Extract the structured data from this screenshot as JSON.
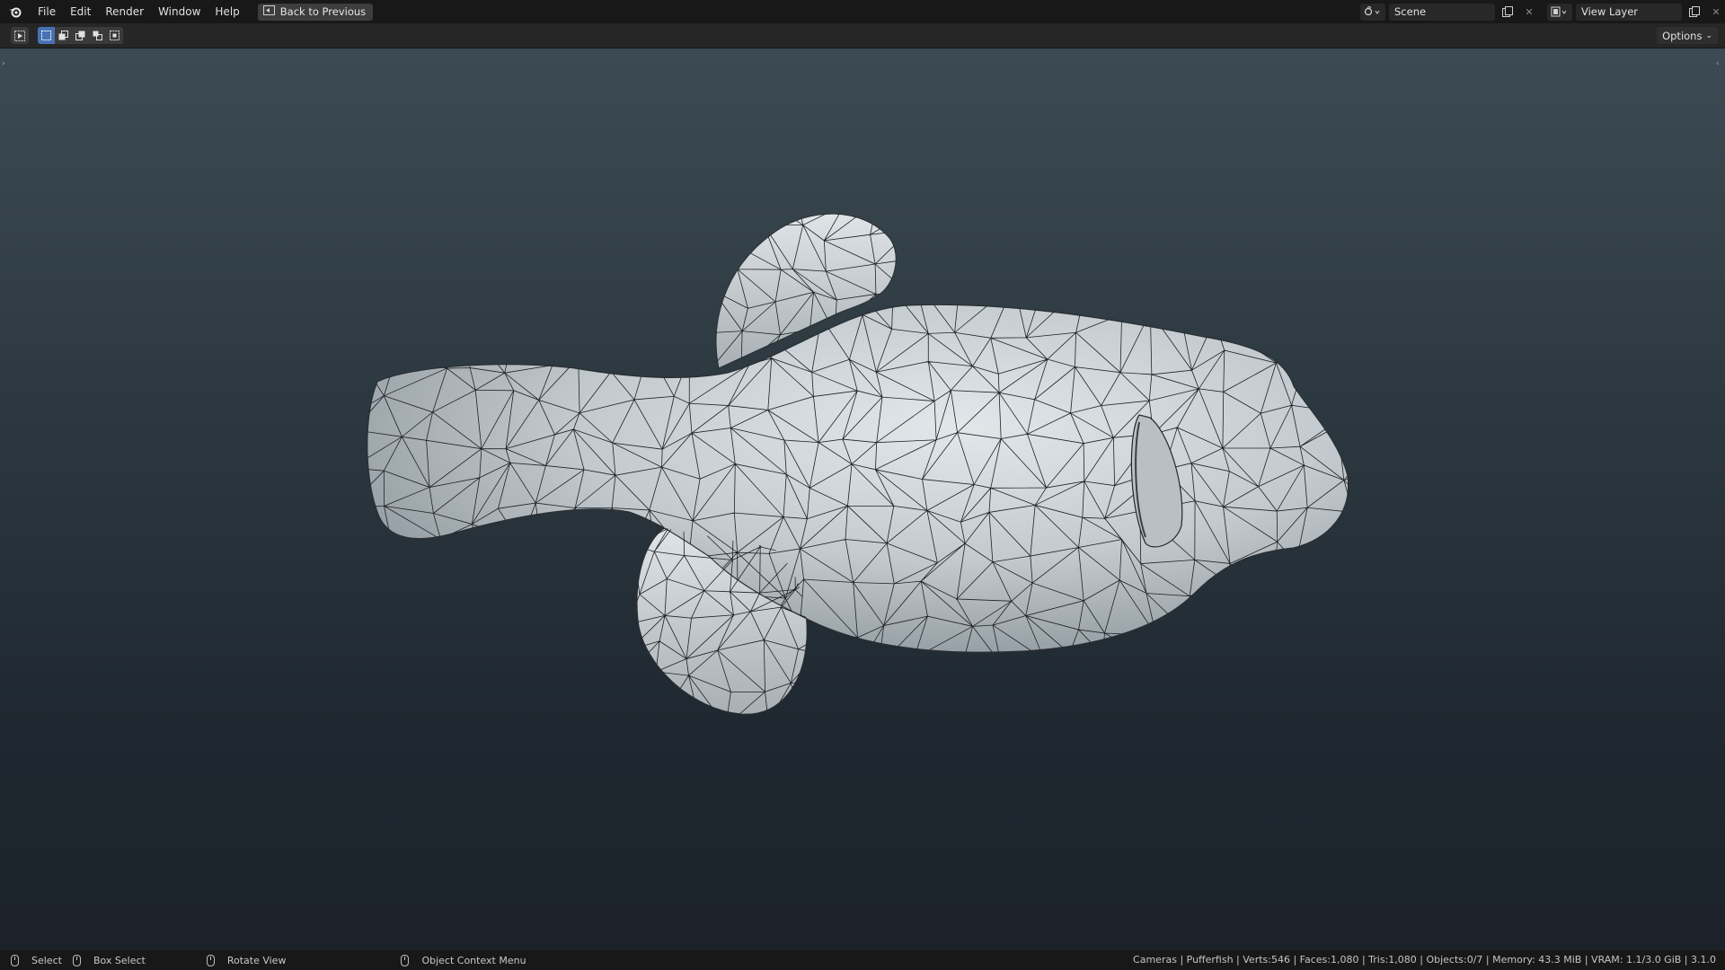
{
  "menu": {
    "items": [
      "File",
      "Edit",
      "Render",
      "Window",
      "Help"
    ],
    "back_button": "Back to Previous"
  },
  "top_right": {
    "scene_name": "Scene",
    "view_layer_name": "View Layer"
  },
  "header": {
    "options_label": "Options"
  },
  "status": {
    "select": "Select",
    "box_select": "Box Select",
    "rotate_view": "Rotate View",
    "context_menu": "Object Context Menu",
    "stats": "Cameras | Pufferfish | Verts:546 | Faces:1,080 | Tris:1,080 | Objects:0/7 | Memory: 43.3 MiB | VRAM: 1.1/3.0 GiB | 3.1.0"
  },
  "colors": {
    "accent": "#4772b3",
    "viewport_top": "#3c4b53",
    "viewport_bottom": "#1b222a",
    "mesh_fill": "#c9cfd3",
    "wire": "#1e2226"
  },
  "icons": [
    "blender-logo-icon",
    "back-icon",
    "scene-icon",
    "view-layer-icon",
    "new-icon",
    "close-icon",
    "select-tool-icon",
    "mouse-left-icon",
    "mouse-middle-icon",
    "mouse-right-icon"
  ]
}
